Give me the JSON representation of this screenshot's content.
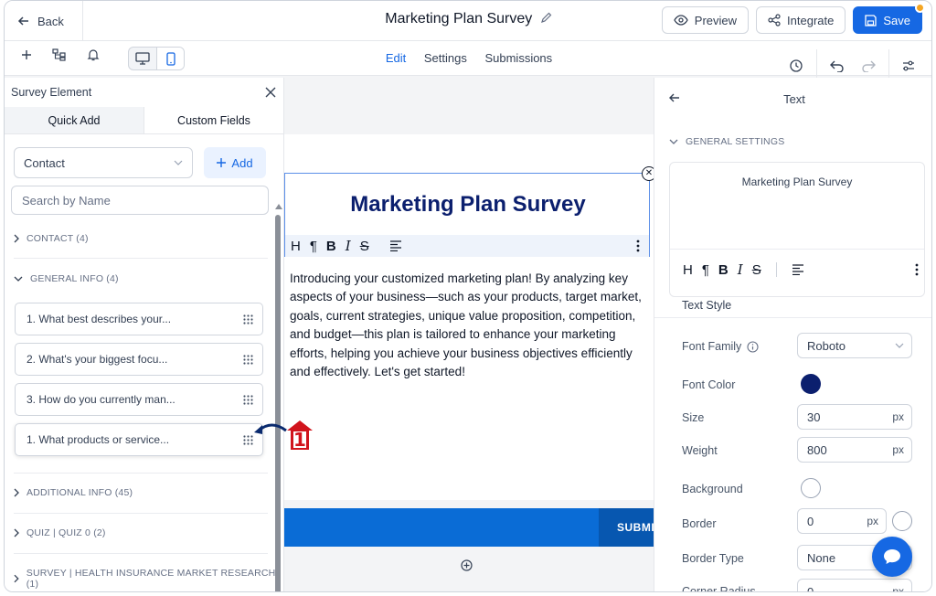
{
  "topbar": {
    "back_label": "Back",
    "title": "Marketing Plan Survey",
    "preview_label": "Preview",
    "integrate_label": "Integrate",
    "save_label": "Save"
  },
  "toolbar": {
    "tabs": [
      {
        "label": "Edit",
        "active": true
      },
      {
        "label": "Settings",
        "active": false
      },
      {
        "label": "Submissions",
        "active": false
      }
    ]
  },
  "left_panel": {
    "title": "Survey Element",
    "tabs": [
      {
        "label": "Quick Add"
      },
      {
        "label": "Custom Fields"
      }
    ],
    "contact_select": "Contact",
    "add_label": "Add",
    "search_placeholder": "Search by Name",
    "groups": [
      {
        "label": "CONTACT (4)",
        "expanded": false
      },
      {
        "label": "GENERAL INFO (4)",
        "expanded": true
      },
      {
        "label": "ADDITIONAL INFO (45)",
        "expanded": false
      },
      {
        "label": "QUIZ | QUIZ 0 (2)",
        "expanded": false
      },
      {
        "label": "SURVEY | HEALTH INSURANCE MARKET RESEARCH (1)",
        "expanded": false
      }
    ],
    "items": [
      {
        "label": "1. What best describes your..."
      },
      {
        "label": "2. What's your biggest focu..."
      },
      {
        "label": "3. How do you currently man..."
      },
      {
        "label": "1. What products or service..."
      }
    ]
  },
  "canvas": {
    "title": "Marketing Plan Survey",
    "intro": "Introducing your customized marketing plan! By analyzing key aspects of your business—such as your products, target market, goals, current strategies, unique value proposition, competition, and budget—this plan is tailored to enhance your marketing efforts, helping you achieve your business objectives efficiently and effectively. Let's get started!",
    "submit_label": "SUBMIT",
    "format_buttons": [
      "H",
      "¶",
      "B",
      "I",
      "S"
    ]
  },
  "right_panel": {
    "title": "Text",
    "section_label": "GENERAL SETTINGS",
    "editor_text": "Marketing Plan Survey",
    "text_style_label": "Text Style",
    "props": {
      "font_family_label": "Font Family",
      "font_family_value": "Roboto",
      "font_color_label": "Font Color",
      "font_color": "#0b1f6e",
      "size_label": "Size",
      "size_value": "30",
      "weight_label": "Weight",
      "weight_value": "800",
      "background_label": "Background",
      "border_label": "Border",
      "border_value": "0",
      "border_type_label": "Border Type",
      "border_type_value": "None",
      "corner_radius_label": "Corner Radius",
      "corner_radius_value": "0",
      "unit": "px"
    }
  },
  "annotation": {
    "number": "1"
  },
  "colors": {
    "primary": "#1668e3",
    "title_navy": "#0b1f6e",
    "submit_blue": "#0a6cd6",
    "annotation_red": "#d1141c"
  }
}
